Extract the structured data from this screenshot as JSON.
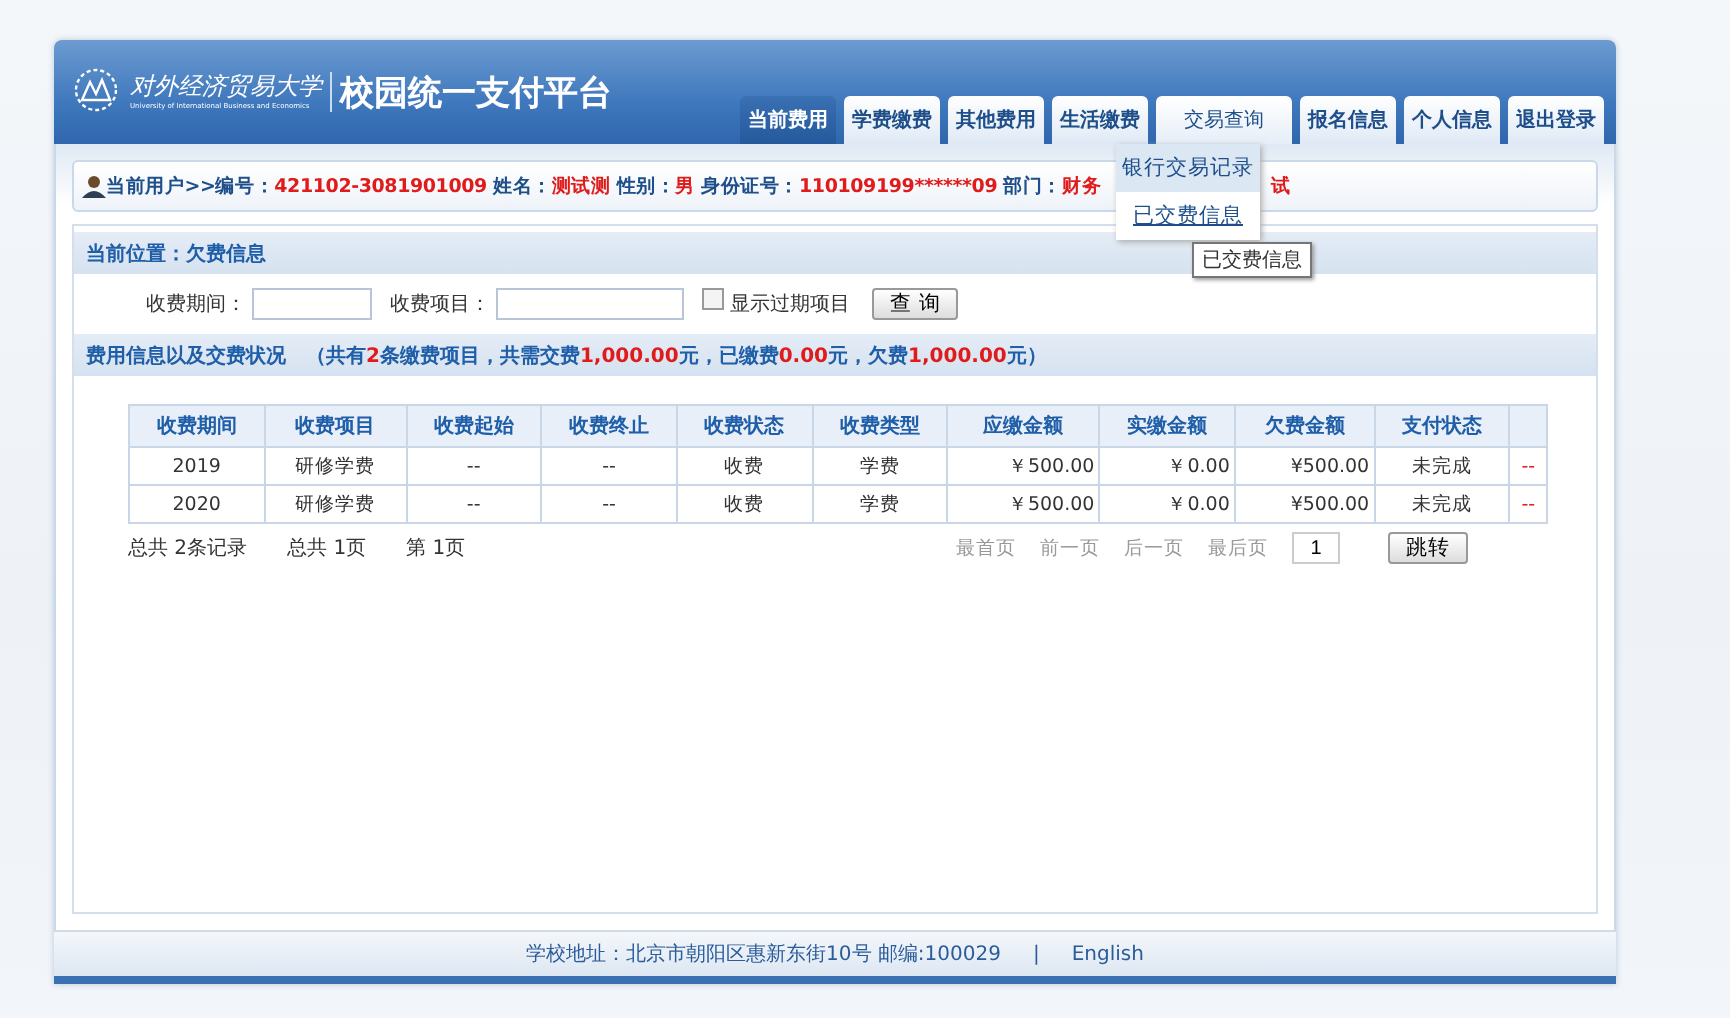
{
  "header": {
    "school_name": "对外经济贸易大学",
    "school_name_en": "University of International Business and Economics",
    "platform_title": "校园统一支付平台"
  },
  "nav_tabs": [
    {
      "label": "当前费用",
      "selected": true,
      "expanded": false
    },
    {
      "label": "学费缴费",
      "selected": false,
      "expanded": false
    },
    {
      "label": "其他费用",
      "selected": false,
      "expanded": false
    },
    {
      "label": "生活缴费",
      "selected": false,
      "expanded": false
    },
    {
      "label": "交易查询",
      "selected": false,
      "expanded": true
    },
    {
      "label": "报名信息",
      "selected": false,
      "expanded": false
    },
    {
      "label": "个人信息",
      "selected": false,
      "expanded": false
    },
    {
      "label": "退出登录",
      "selected": false,
      "expanded": false
    }
  ],
  "dropdown_menu": [
    {
      "label": "银行交易记录",
      "selected": true
    },
    {
      "label": "已交费信息",
      "selected": false
    }
  ],
  "tooltip": "已交费信息",
  "user_info": {
    "prefix": "当前用户>>",
    "fields": [
      {
        "label": "编号：",
        "value": "421102-3081901009"
      },
      {
        "label": "姓名：",
        "value": "测试测"
      },
      {
        "label": "性别：",
        "value": "男"
      },
      {
        "label": "身份证号：",
        "value": "110109199******09"
      },
      {
        "label": "部门：",
        "value": "财务"
      }
    ],
    "hidden_tail": "试"
  },
  "breadcrumb": "当前位置：欠费信息",
  "filters": {
    "period_label": "收费期间：",
    "item_label": "收费项目：",
    "show_expired": {
      "label": "显示过期项目",
      "checked": false
    },
    "query_button": "查 询"
  },
  "summary": {
    "title": "费用信息以及交费状况",
    "text": "（共有**2**条缴费项目，共需交费**1,000.00**元，已缴费**0.00**元，欠费**1,000.00**元）"
  },
  "table": {
    "columns": [
      "收费期间",
      "收费项目",
      "收费起始",
      "收费终止",
      "收费状态",
      "收费类型",
      "应缴金额",
      "实缴金额",
      "欠费金额",
      "支付状态"
    ],
    "rows": [
      [
        "2019",
        "研修学费",
        "--",
        "--",
        "收费",
        "学费",
        "￥500.00",
        "￥0.00",
        "¥500.00",
        "未完成",
        "--"
      ],
      [
        "2020",
        "研修学费",
        "--",
        "--",
        "收费",
        "学费",
        "￥500.00",
        "￥0.00",
        "¥500.00",
        "未完成",
        "--"
      ]
    ]
  },
  "pager": {
    "total_records": "总共  2条记录",
    "total_pages": "总共  1页",
    "current_page": "第 1页",
    "first": "最首页",
    "prev": "前一页",
    "next": "后一页",
    "last": "最后页",
    "page_input": "1",
    "go_button": "跳转"
  },
  "footer": {
    "address": "学校地址：北京市朝阳区惠新东街10号 邮编:100029",
    "separator": "|",
    "language_link": "English"
  }
}
